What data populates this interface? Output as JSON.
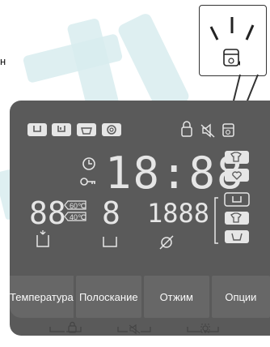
{
  "partial_text": "н",
  "display": {
    "clock": "18:88",
    "temperature_digits": "88",
    "temperature_options": [
      "60℃",
      "40℃"
    ],
    "rinse_digit": "8",
    "spin_digits": "1888"
  },
  "buttons": {
    "temperature": "Температура",
    "rinse": "Полоскание",
    "spin": "Отжим",
    "options": "Опции"
  },
  "colors": {
    "panel": "#5a5a5a",
    "button": "#676767",
    "indicator": "#e6e6e6"
  },
  "icons": {
    "callout": "drum-clean-indicator-icon",
    "lock_combo": "child-lock-icon",
    "mute_combo": "sound-off-icon",
    "smart_combo": "smart-check-icon"
  }
}
